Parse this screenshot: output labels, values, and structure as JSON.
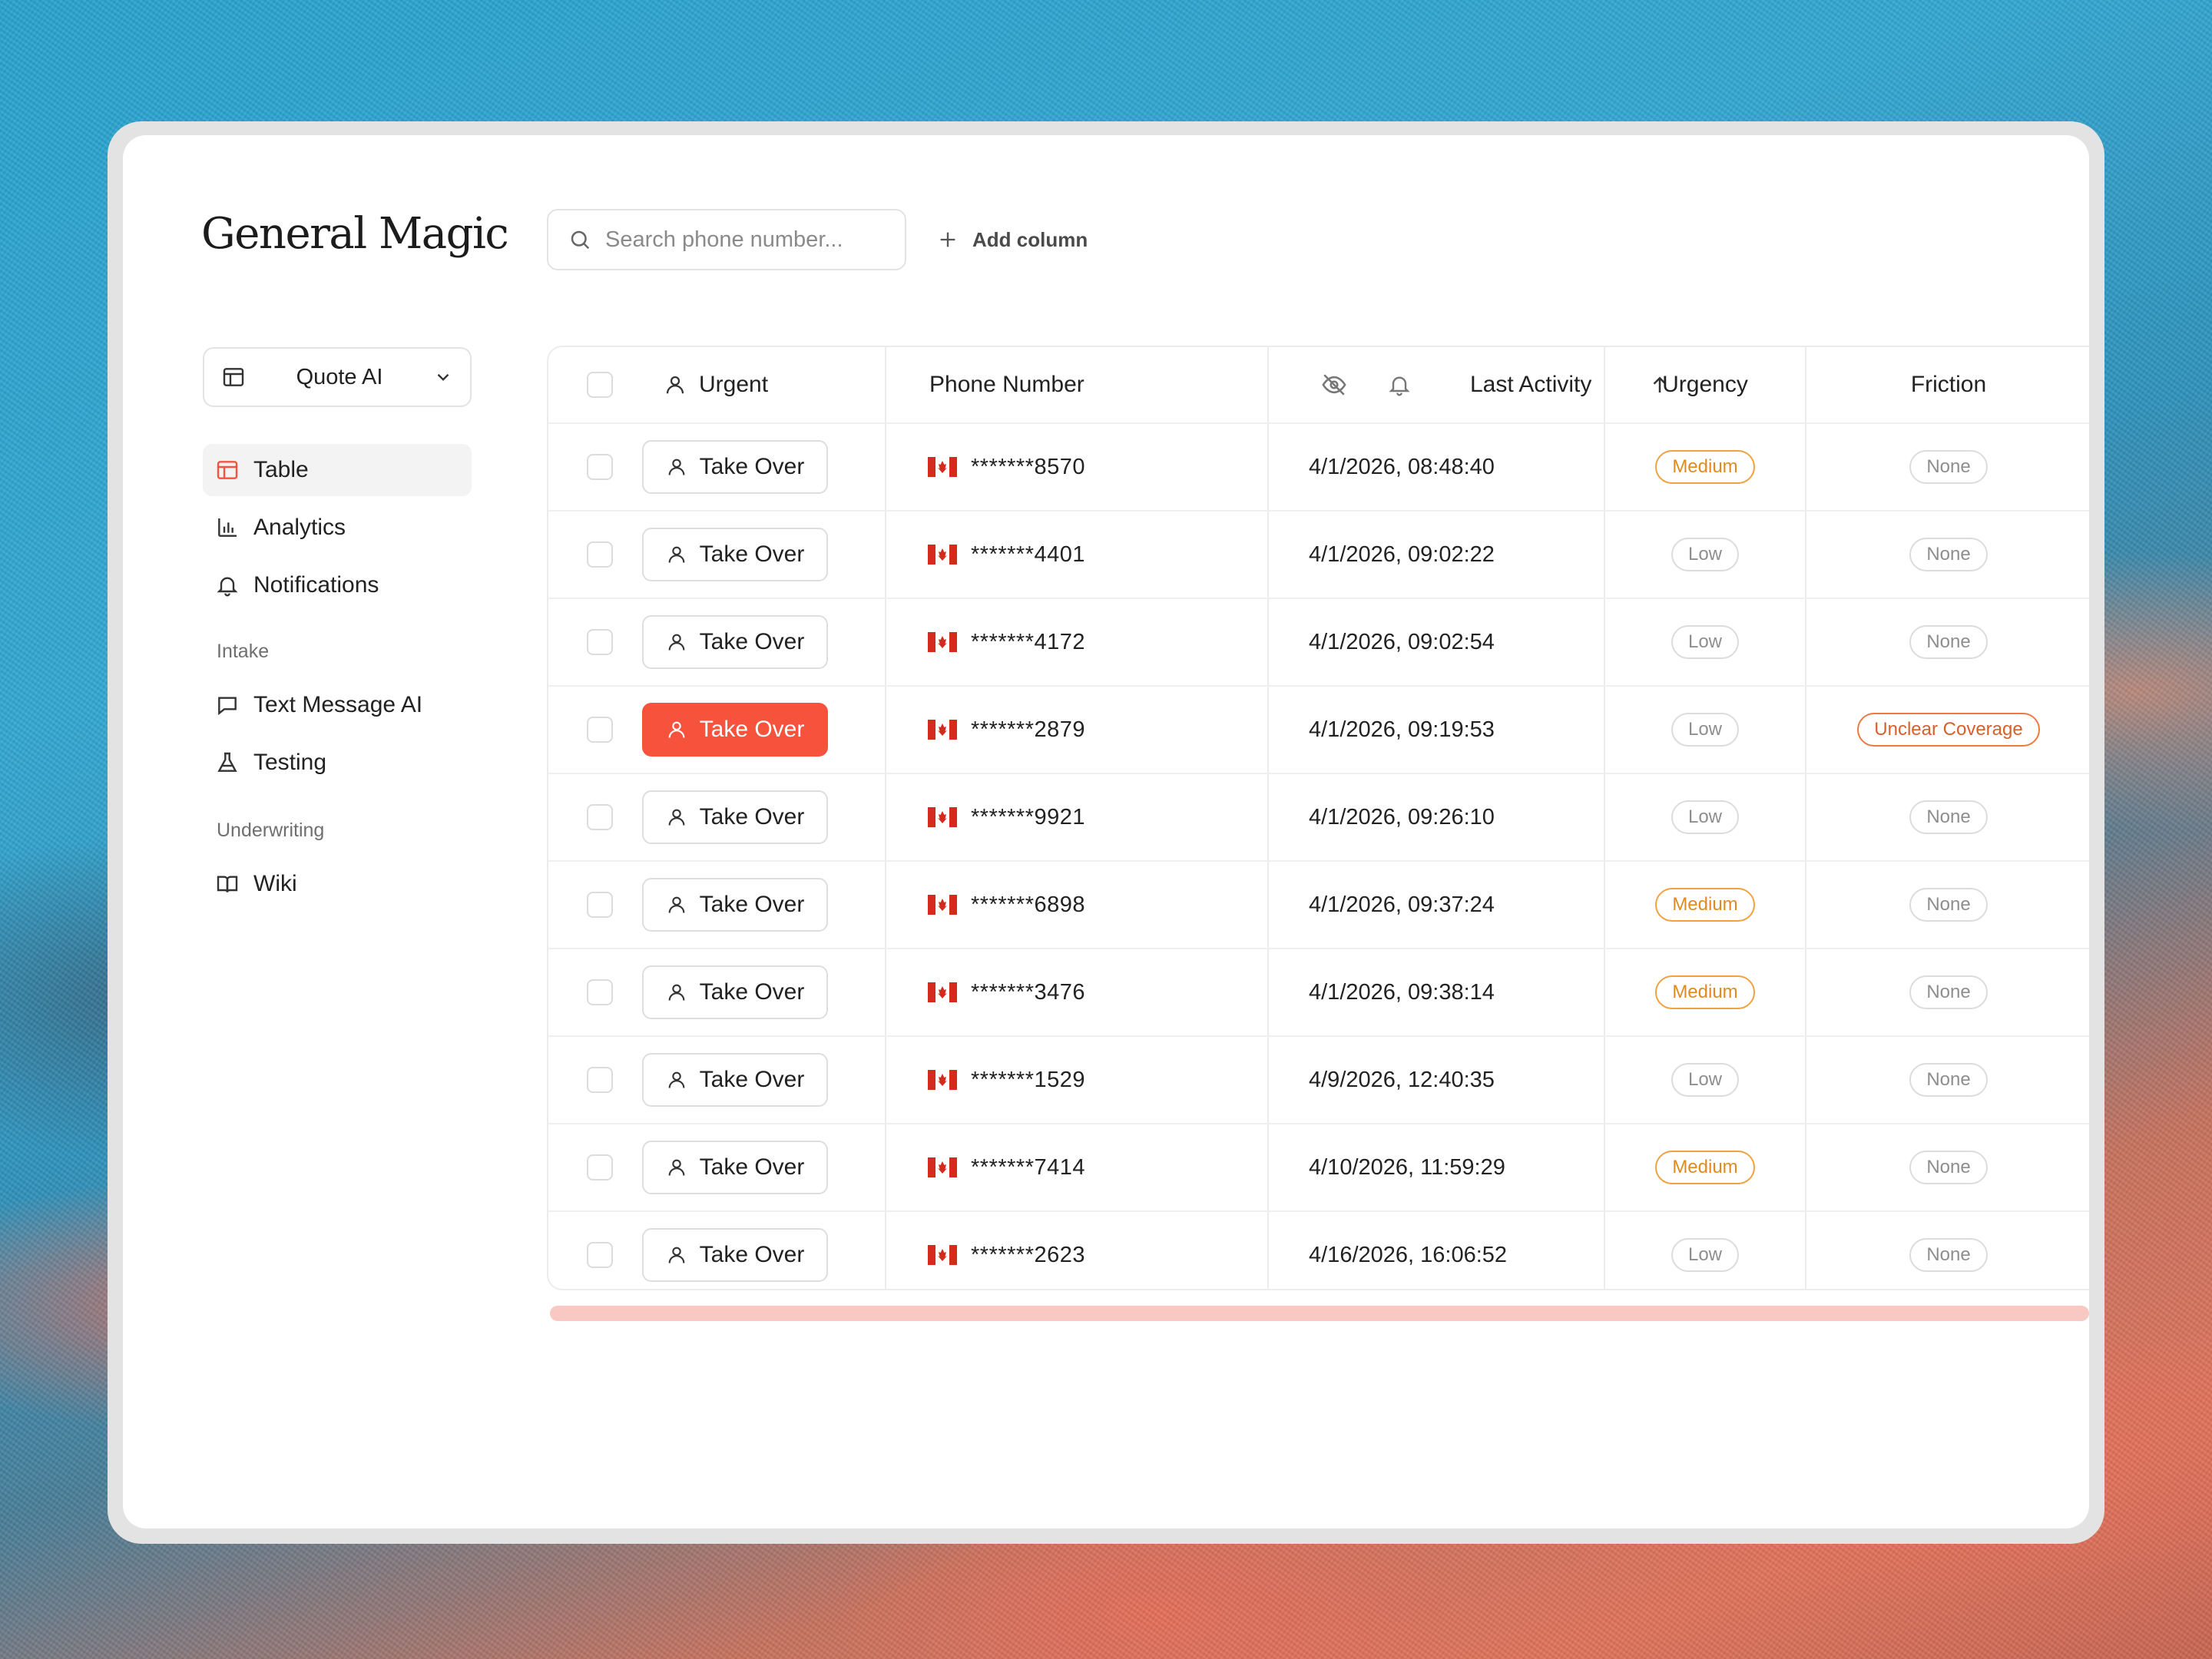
{
  "app": {
    "logo": "General Magic",
    "search_placeholder": "Search phone number...",
    "add_column_label": "Add column",
    "workspace": "Quote AI"
  },
  "sidebar": {
    "items": [
      {
        "label": "Table",
        "icon": "table-icon",
        "active": true
      },
      {
        "label": "Analytics",
        "icon": "bar-chart-icon",
        "active": false
      },
      {
        "label": "Notifications",
        "icon": "bell-icon",
        "active": false
      }
    ],
    "sections": [
      {
        "title": "Intake",
        "items": [
          {
            "label": "Text Message AI",
            "icon": "message-icon"
          },
          {
            "label": "Testing",
            "icon": "flask-icon"
          }
        ]
      },
      {
        "title": "Underwriting",
        "items": [
          {
            "label": "Wiki",
            "icon": "book-icon"
          }
        ]
      }
    ]
  },
  "table": {
    "headers": {
      "urgent": "Urgent",
      "phone": "Phone Number",
      "last_activity": "Last Activity",
      "urgency": "Urgency",
      "friction": "Friction"
    },
    "rows": [
      {
        "action": "Take Over",
        "highlight": false,
        "phone": "*******8570",
        "last_activity": "4/1/2026, 08:48:40",
        "urgency": "Medium",
        "friction": "None"
      },
      {
        "action": "Take Over",
        "highlight": false,
        "phone": "*******4401",
        "last_activity": "4/1/2026, 09:02:22",
        "urgency": "Low",
        "friction": "None"
      },
      {
        "action": "Take Over",
        "highlight": false,
        "phone": "*******4172",
        "last_activity": "4/1/2026, 09:02:54",
        "urgency": "Low",
        "friction": "None"
      },
      {
        "action": "Take Over",
        "highlight": true,
        "phone": "*******2879",
        "last_activity": "4/1/2026, 09:19:53",
        "urgency": "Low",
        "friction": "Unclear Coverage"
      },
      {
        "action": "Take Over",
        "highlight": false,
        "phone": "*******9921",
        "last_activity": "4/1/2026, 09:26:10",
        "urgency": "Low",
        "friction": "None"
      },
      {
        "action": "Take Over",
        "highlight": false,
        "phone": "*******6898",
        "last_activity": "4/1/2026, 09:37:24",
        "urgency": "Medium",
        "friction": "None"
      },
      {
        "action": "Take Over",
        "highlight": false,
        "phone": "*******3476",
        "last_activity": "4/1/2026, 09:38:14",
        "urgency": "Medium",
        "friction": "None"
      },
      {
        "action": "Take Over",
        "highlight": false,
        "phone": "*******1529",
        "last_activity": "4/9/2026, 12:40:35",
        "urgency": "Low",
        "friction": "None"
      },
      {
        "action": "Take Over",
        "highlight": false,
        "phone": "*******7414",
        "last_activity": "4/10/2026, 11:59:29",
        "urgency": "Medium",
        "friction": "None"
      },
      {
        "action": "Take Over",
        "highlight": false,
        "phone": "*******2623",
        "last_activity": "4/16/2026, 16:06:52",
        "urgency": "Low",
        "friction": "None"
      }
    ]
  },
  "colors": {
    "accent": "#f6523c",
    "medium_badge": "#f0a240",
    "friction_badge": "#ee7a40",
    "flag_red": "#d52b1e"
  }
}
